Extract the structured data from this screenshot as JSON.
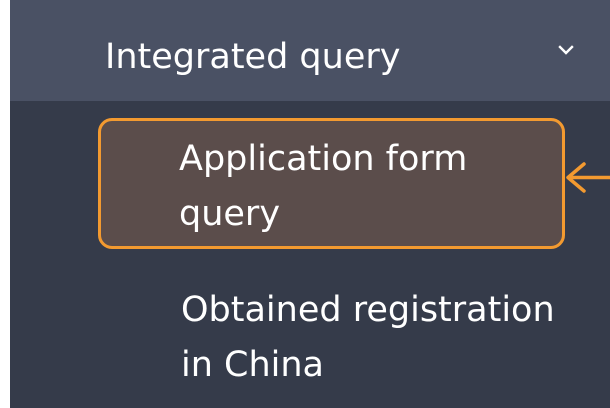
{
  "menu": {
    "header": {
      "label": "Integrated query",
      "toggle_icon": "chevron-down-icon"
    },
    "items": [
      {
        "label": "Application form query",
        "active": true
      },
      {
        "label": "Obtained registration in China",
        "active": false
      }
    ]
  },
  "annotation": {
    "icon": "left-arrow-icon",
    "color": "#f39a30"
  },
  "colors": {
    "sidebar_background": "#353b4a",
    "header_background": "#4a5164",
    "active_item_background": "#5b4d4b",
    "highlight": "#f39a30",
    "text": "#ffffff"
  }
}
